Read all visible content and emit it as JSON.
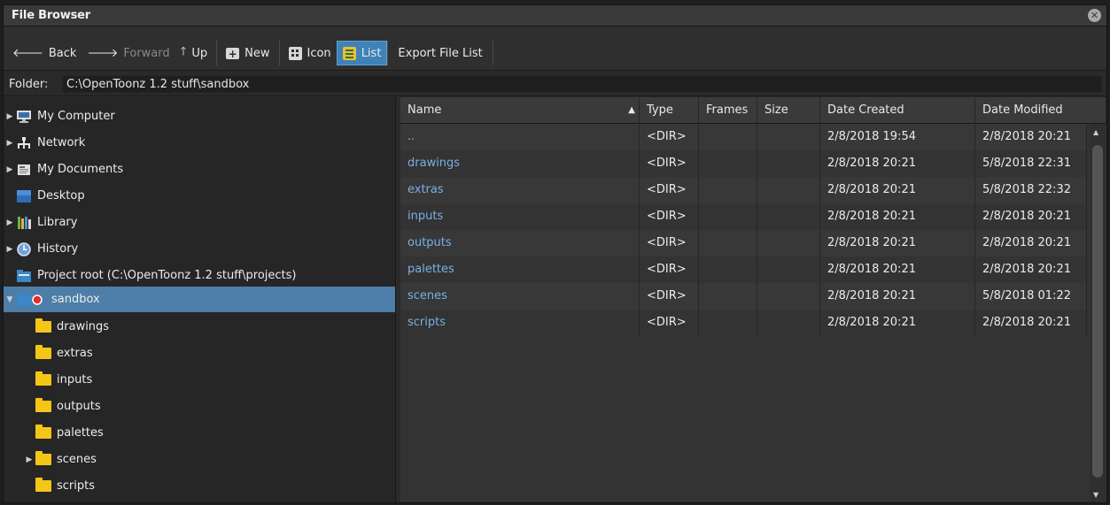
{
  "window": {
    "title": "File Browser"
  },
  "toolbar": {
    "back": "Back",
    "forward": "Forward",
    "up": "Up",
    "new": "New",
    "icon": "Icon",
    "list": "List",
    "export": "Export File List"
  },
  "folder": {
    "label": "Folder:",
    "path": "C:\\OpenToonz 1.2 stuff\\sandbox"
  },
  "tree": {
    "items": [
      {
        "label": "My Computer"
      },
      {
        "label": "Network"
      },
      {
        "label": "My Documents"
      },
      {
        "label": "Desktop"
      },
      {
        "label": "Library"
      },
      {
        "label": "History"
      },
      {
        "label": "Project root (C:\\OpenToonz 1.2 stuff\\projects)"
      },
      {
        "label": "sandbox"
      },
      {
        "label": "drawings"
      },
      {
        "label": "extras"
      },
      {
        "label": "inputs"
      },
      {
        "label": "outputs"
      },
      {
        "label": "palettes"
      },
      {
        "label": "scenes"
      },
      {
        "label": "scripts"
      }
    ]
  },
  "columns": {
    "name": "Name",
    "type": "Type",
    "frames": "Frames",
    "size": "Size",
    "created": "Date Created",
    "modified": "Date Modified"
  },
  "files": [
    {
      "name": "..",
      "type": "<DIR>",
      "created": "2/8/2018 19:54",
      "modified": "2/8/2018 20:21"
    },
    {
      "name": "drawings",
      "type": "<DIR>",
      "created": "2/8/2018 20:21",
      "modified": "5/8/2018 22:31"
    },
    {
      "name": "extras",
      "type": "<DIR>",
      "created": "2/8/2018 20:21",
      "modified": "5/8/2018 22:32"
    },
    {
      "name": "inputs",
      "type": "<DIR>",
      "created": "2/8/2018 20:21",
      "modified": "2/8/2018 20:21"
    },
    {
      "name": "outputs",
      "type": "<DIR>",
      "created": "2/8/2018 20:21",
      "modified": "2/8/2018 20:21"
    },
    {
      "name": "palettes",
      "type": "<DIR>",
      "created": "2/8/2018 20:21",
      "modified": "2/8/2018 20:21"
    },
    {
      "name": "scenes",
      "type": "<DIR>",
      "created": "2/8/2018 20:21",
      "modified": "5/8/2018 01:22"
    },
    {
      "name": "scripts",
      "type": "<DIR>",
      "created": "2/8/2018 20:21",
      "modified": "2/8/2018 20:21"
    }
  ]
}
